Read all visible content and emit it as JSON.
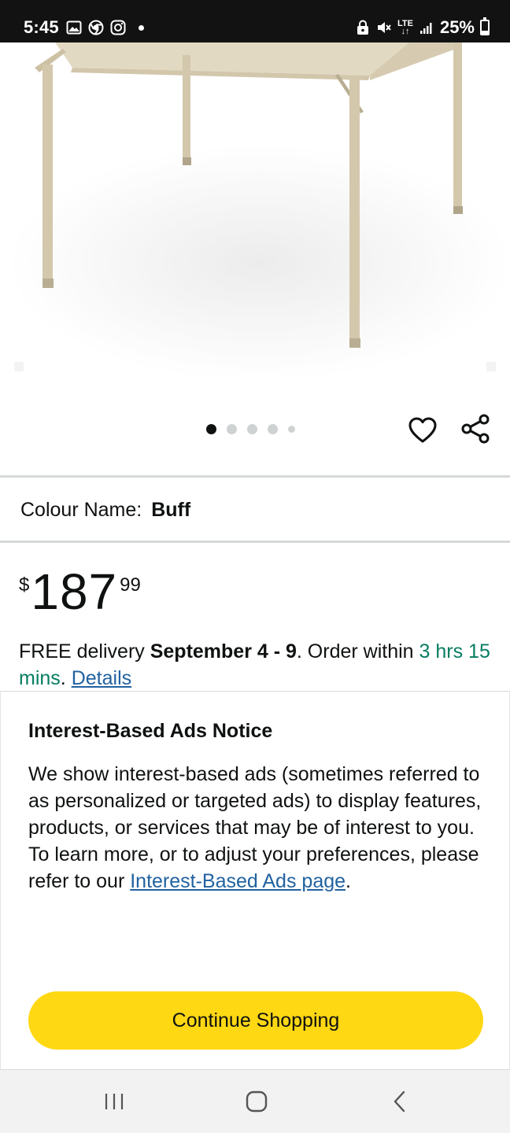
{
  "status_bar": {
    "time": "5:45",
    "network": "LTE",
    "battery_text": "25%",
    "battery_level": 0.25,
    "icons": [
      "gallery-icon",
      "chrome-icon",
      "instagram-icon",
      "notification-dot-icon",
      "vpn-lock-icon",
      "mute-icon",
      "lte-icon",
      "signal-icon",
      "battery-icon"
    ]
  },
  "product": {
    "image_icon": "folding-table-image",
    "carousel": {
      "count": 5,
      "active_index": 0
    },
    "wishlist_icon": "heart-icon",
    "share_icon": "share-icon"
  },
  "colour": {
    "label": "Colour Name:",
    "value": "Buff"
  },
  "price": {
    "symbol": "$",
    "whole": "187",
    "fraction": "99"
  },
  "delivery": {
    "prefix": "FREE delivery ",
    "dates": "September 4 - 9",
    "middle": ". Order within ",
    "countdown": "3 hrs 15 mins",
    "after_countdown": ". ",
    "details_link": "Details"
  },
  "notice": {
    "title": "Interest-Based Ads Notice",
    "body": "We show interest-based ads (sometimes referred to as personalized or targeted ads) to display features, products, or services that may be of interest to you. To learn more, or to adjust your preferences, please refer to our ",
    "link": "Interest-Based Ads page",
    "body_end": ".",
    "button": "Continue Shopping"
  },
  "colors": {
    "accent_yellow": "#ffd814",
    "link_blue": "#2162a1",
    "countdown_green": "#067d62",
    "status_bar": "#121212"
  },
  "nav_bar": {
    "icons": [
      "recent-apps-icon",
      "home-icon",
      "back-icon"
    ]
  }
}
